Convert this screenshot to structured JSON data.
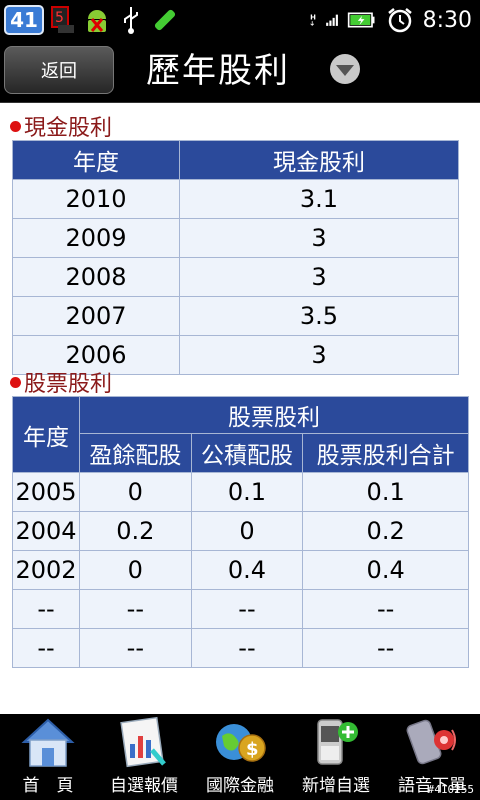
{
  "status_bar": {
    "notification_count": "41",
    "time": "8:30",
    "icons": [
      "calendar-icon",
      "android-debug-icon",
      "usb-icon",
      "battery-app-icon",
      "signal-h-icon",
      "battery-icon",
      "alarm-icon"
    ]
  },
  "header": {
    "back_label": "返回",
    "title": "歷年股利"
  },
  "cash_dividend": {
    "section_title": "現金股利",
    "columns": [
      "年度",
      "現金股利"
    ],
    "rows": [
      {
        "year": "2010",
        "value": "3.1"
      },
      {
        "year": "2009",
        "value": "3"
      },
      {
        "year": "2008",
        "value": "3"
      },
      {
        "year": "2007",
        "value": "3.5"
      },
      {
        "year": "2006",
        "value": "3"
      }
    ]
  },
  "stock_dividend": {
    "section_title": "股票股利",
    "year_header": "年度",
    "group_header": "股票股利",
    "columns": [
      "盈餘配股",
      "公積配股",
      "股票股利合計"
    ],
    "rows": [
      {
        "year": "2005",
        "earnings": "0",
        "reserve": "0.1",
        "total": "0.1"
      },
      {
        "year": "2004",
        "earnings": "0.2",
        "reserve": "0",
        "total": "0.2"
      },
      {
        "year": "2002",
        "earnings": "0",
        "reserve": "0.4",
        "total": "0.4"
      },
      {
        "year": "--",
        "earnings": "--",
        "reserve": "--",
        "total": "--"
      },
      {
        "year": "--",
        "earnings": "--",
        "reserve": "--",
        "total": "--"
      }
    ]
  },
  "bottom_nav": [
    {
      "label": "首　頁",
      "icon": "home-icon"
    },
    {
      "label": "自選報價",
      "icon": "quote-chart-icon"
    },
    {
      "label": "國際金融",
      "icon": "globe-money-icon"
    },
    {
      "label": "新增自選",
      "icon": "phone-add-icon"
    },
    {
      "label": "語音下單",
      "icon": "voice-order-icon"
    }
  ],
  "watermark": "#410255",
  "colors": {
    "table_header": "#2b4a9b",
    "table_cell": "#eef3fb",
    "section_title": "#8b1a1a",
    "bullet": "#dd1111"
  }
}
